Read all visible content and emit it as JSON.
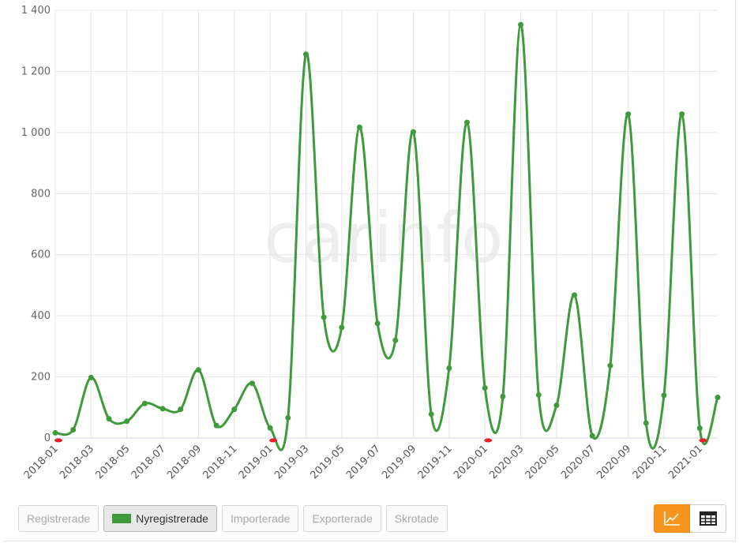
{
  "watermark": "carinfo",
  "chart_data": {
    "type": "line",
    "x": [
      "2018-01",
      "2018-02",
      "2018-03",
      "2018-04",
      "2018-05",
      "2018-06",
      "2018-07",
      "2018-08",
      "2018-09",
      "2018-10",
      "2018-11",
      "2018-12",
      "2019-01",
      "2019-02",
      "2019-03",
      "2019-04",
      "2019-05",
      "2019-06",
      "2019-07",
      "2019-08",
      "2019-09",
      "2019-10",
      "2019-11",
      "2019-12",
      "2020-01",
      "2020-02",
      "2020-03",
      "2020-04",
      "2020-05",
      "2020-06",
      "2020-07",
      "2020-08",
      "2020-09",
      "2020-10",
      "2020-11",
      "2020-12",
      "2021-01",
      "2021-02"
    ],
    "xticks": [
      "2018-01",
      "2018-03",
      "2018-05",
      "2018-07",
      "2018-09",
      "2018-11",
      "2019-01",
      "2019-03",
      "2019-05",
      "2019-07",
      "2019-09",
      "2019-11",
      "2020-01",
      "2020-03",
      "2020-05",
      "2020-07",
      "2020-09",
      "2020-11",
      "2021-01"
    ],
    "yticks": [
      "0",
      "200",
      "400",
      "600",
      "800",
      "1 000",
      "1 200",
      "1 400"
    ],
    "ylim": [
      0,
      1400
    ],
    "grid": true,
    "series": [
      {
        "name": "Nyregistrerade",
        "color": "#3e9a3a",
        "values": [
          17,
          27,
          198,
          63,
          55,
          113,
          96,
          94,
          223,
          41,
          94,
          179,
          33,
          66,
          1256,
          395,
          362,
          1017,
          375,
          320,
          1002,
          78,
          229,
          1033,
          164,
          136,
          1353,
          141,
          107,
          468,
          7,
          237,
          1060,
          49,
          140,
          1060,
          32,
          133
        ]
      }
    ],
    "zero_markers": [
      "2018-01",
      "2019-01",
      "2020-01",
      "2021-01"
    ]
  },
  "legend": [
    {
      "label": "Registrerade",
      "active": false
    },
    {
      "label": "Nyregistrerade",
      "active": true,
      "color": "#3e9a3a"
    },
    {
      "label": "Importerade",
      "active": false
    },
    {
      "label": "Exporterade",
      "active": false
    },
    {
      "label": "Skrotade",
      "active": false
    }
  ],
  "view_toggle": [
    {
      "icon": "line-chart-icon",
      "active": true
    },
    {
      "icon": "table-icon",
      "active": false
    }
  ]
}
